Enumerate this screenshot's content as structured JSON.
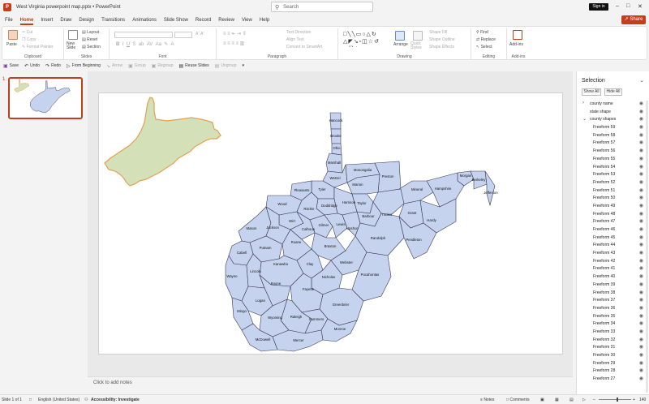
{
  "titlebar": {
    "doc_title": "West Virginia powerpoint map.pptx  •  PowerPoint",
    "search_placeholder": "Search",
    "signin": "Sign in"
  },
  "menu": {
    "tabs": [
      "File",
      "Home",
      "Insert",
      "Draw",
      "Design",
      "Transitions",
      "Animations",
      "Slide Show",
      "Record",
      "Review",
      "View",
      "Help"
    ],
    "active": "Home",
    "share": "Share"
  },
  "ribbon": {
    "clipboard": {
      "paste": "Paste",
      "cut": "Cut",
      "copy": "Copy",
      "format_painter": "Format Painter",
      "label": "Clipboard"
    },
    "slides": {
      "new_slide": "New Slide",
      "layout": "Layout",
      "reset": "Reset",
      "section": "Section",
      "label": "Slides"
    },
    "font": {
      "label": "Font"
    },
    "paragraph": {
      "text_direction": "Text Direction",
      "align_text": "Align Text",
      "smartart": "Convert to SmartArt",
      "label": "Paragraph"
    },
    "drawing": {
      "arrange": "Arrange",
      "quick_styles": "Quick Styles",
      "shape_fill": "Shape Fill",
      "shape_outline": "Shape Outline",
      "shape_effects": "Shape Effects",
      "label": "Drawing"
    },
    "editing": {
      "find": "Find",
      "replace": "Replace",
      "select": "Select",
      "label": "Editing"
    },
    "addins": {
      "addins": "Add-ins",
      "label": "Add-ins"
    }
  },
  "qat": {
    "items": [
      {
        "label": "Save",
        "icon": "save-icon",
        "enabled": true
      },
      {
        "label": "Undo",
        "icon": "undo-icon",
        "enabled": true
      },
      {
        "label": "Redo",
        "icon": "redo-icon",
        "enabled": true
      },
      {
        "label": "From Beginning",
        "icon": "present-icon",
        "enabled": true
      },
      {
        "label": "Arrow",
        "icon": "arrow-icon",
        "enabled": false
      },
      {
        "label": "Group",
        "icon": "group-icon",
        "enabled": false
      },
      {
        "label": "Regroup",
        "icon": "regroup-icon",
        "enabled": false
      },
      {
        "label": "Reuse Slides",
        "icon": "reuse-slides-icon",
        "enabled": true
      },
      {
        "label": "Ungroup",
        "icon": "ungroup-icon",
        "enabled": false
      }
    ]
  },
  "thumbnails": {
    "number": "1"
  },
  "notes": {
    "placeholder": "Click to add notes"
  },
  "selection": {
    "title": "Selection",
    "show_all": "Show All",
    "hide_all": "Hide All",
    "items": [
      "county name",
      "state shape",
      "county shapes",
      "Freeform 59",
      "Freeform 58",
      "Freeform 57",
      "Freeform 56",
      "Freeform 55",
      "Freeform 54",
      "Freeform 53",
      "Freeform 52",
      "Freeform 51",
      "Freeform 50",
      "Freeform 49",
      "Freeform 48",
      "Freeform 47",
      "Freeform 46",
      "Freeform 45",
      "Freeform 44",
      "Freeform 43",
      "Freeform 42",
      "Freeform 41",
      "Freeform 40",
      "Freeform 39",
      "Freeform 38",
      "Freeform 37",
      "Freeform 36",
      "Freeform 35",
      "Freeform 34",
      "Freeform 33",
      "Freeform 32",
      "Freeform 31",
      "Freeform 30",
      "Freeform 29",
      "Freeform 28",
      "Freeform 27"
    ]
  },
  "status": {
    "slide": "Slide 1 of 1",
    "language": "English (United States)",
    "accessibility": "Accessibility: Investigate",
    "notes": "Notes",
    "comments": "Comments",
    "zoom": "140"
  },
  "map": {
    "counties": [
      "Hancock",
      "Brooke",
      "Ohio",
      "Marshall",
      "Wetzel",
      "Monongalia",
      "Preston",
      "Marion",
      "Tyler",
      "Pleasants",
      "Doddridge",
      "Harrison",
      "Taylor",
      "Morgan",
      "Berkeley",
      "Jefferson",
      "Mineral",
      "Hampshire",
      "Wood",
      "Ritchie",
      "Barbour",
      "Tucker",
      "Grant",
      "Hardy",
      "Wirt",
      "Gilmer",
      "Lewis",
      "Upshur",
      "Calhoun",
      "Mason",
      "Jackson",
      "Randolph",
      "Pendleton",
      "Roane",
      "Braxton",
      "Putnam",
      "Cabell",
      "Kanawha",
      "Clay",
      "Webster",
      "Wayne",
      "Lincoln",
      "Nicholas",
      "Pocahontas",
      "Boone",
      "Fayette",
      "Greenbrier",
      "Logan",
      "Mingo",
      "Raleigh",
      "Wyoming",
      "Summers",
      "Monroe",
      "McDowell",
      "Mercer"
    ],
    "state_fill": "#d3e0b8",
    "state_stroke": "#e5a050",
    "county_fill": "#c5d3ee",
    "county_stroke": "#3a3a55"
  },
  "colors": {
    "accent": "#c43e1c"
  }
}
